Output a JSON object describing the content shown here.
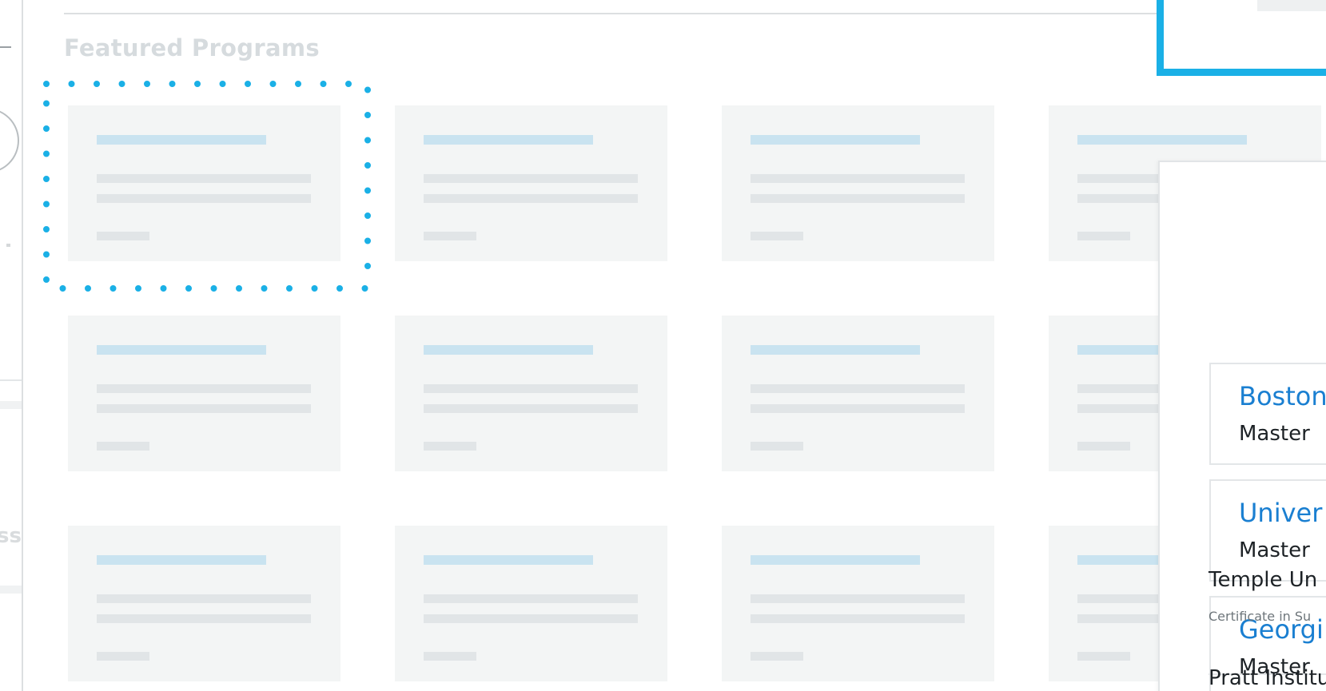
{
  "section": {
    "title": "Featured Programs"
  },
  "skeleton_grid": {
    "columns": 4,
    "rows": 3,
    "cards": [
      {
        "state": "loading"
      },
      {
        "state": "loading"
      },
      {
        "state": "loading"
      },
      {
        "state": "loading"
      },
      {
        "state": "loading"
      },
      {
        "state": "loading"
      },
      {
        "state": "loading"
      },
      {
        "state": "loading"
      },
      {
        "state": "loading"
      },
      {
        "state": "loading"
      },
      {
        "state": "loading"
      },
      {
        "state": "loading"
      }
    ]
  },
  "left_fragment": {
    "clipped_text": "ss"
  },
  "results_panel": {
    "highlighted_results": [
      {
        "name": "Boston",
        "degree": "Master"
      },
      {
        "name": "Univer",
        "degree": "Master"
      },
      {
        "name": "Georgi",
        "degree": "Master"
      }
    ],
    "plain_results": [
      {
        "name": "Temple Un",
        "subtitle": "Certificate in Su"
      },
      {
        "name": "Pratt Institu",
        "subtitle": ""
      }
    ]
  },
  "colors": {
    "accent_highlight": "#1ab0e6",
    "link": "#1a7fd1",
    "skeleton_bg": "#f3f5f5",
    "skeleton_title": "#c9e3f0",
    "skeleton_line": "#e1e5e7",
    "section_title": "#d6dbde"
  },
  "icons": {
    "dotted_highlight": "dotted-selection-frame",
    "blue_box": "selection-frame"
  }
}
